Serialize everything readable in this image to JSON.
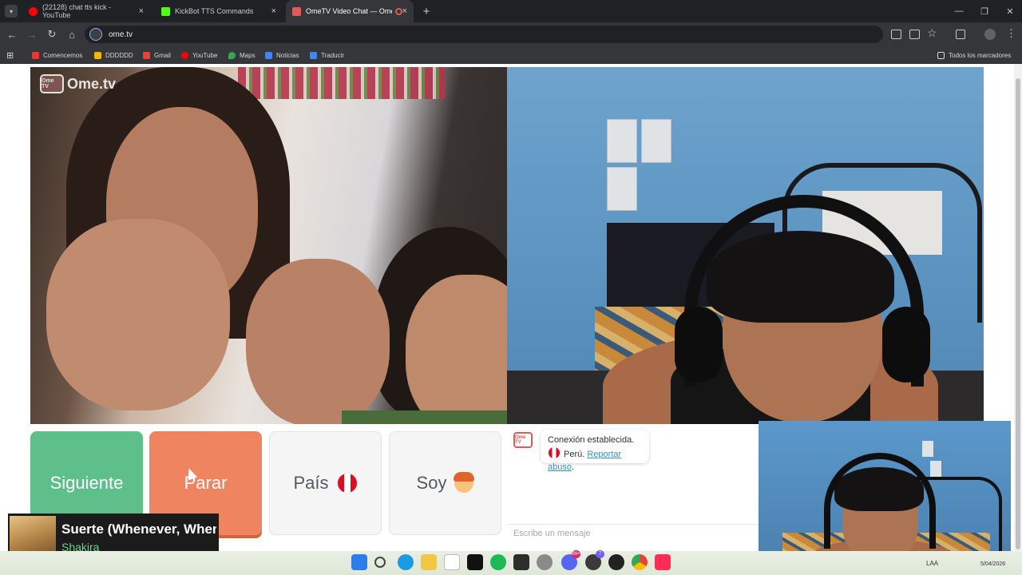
{
  "browser": {
    "tabs": [
      {
        "title": "(22128) chat tts kick - YouTube",
        "icon": "youtube-icon",
        "color": "#ff0000"
      },
      {
        "title": "KickBot TTS Commands",
        "icon": "kickbot-icon",
        "color": "#53fc18"
      },
      {
        "title": "OmeTV Video Chat — Ome",
        "icon": "ometv-icon",
        "color": "#e05a5a",
        "active": true
      }
    ],
    "tab_close": "×",
    "new_tab": "+",
    "window_controls": {
      "minimize": "—",
      "restore": "❐",
      "close": "✕"
    },
    "nav": {
      "back": "←",
      "forward": "→",
      "reload": "↻",
      "home": "⌂"
    },
    "url": "ome.tv",
    "bookmarks": [
      {
        "label": "Comencemos",
        "color": "#e53935"
      },
      {
        "label": "DDDDDD",
        "color": "#f5b700"
      },
      {
        "label": "Gmail",
        "color": "#ea4335"
      },
      {
        "label": "YouTube",
        "color": "#ff0000"
      },
      {
        "label": "Maps",
        "color": "#34a853"
      },
      {
        "label": "Noticias",
        "color": "#4285f4"
      },
      {
        "label": "Traducir",
        "color": "#4285f4"
      }
    ],
    "all_bookmarks": "Todos los marcadores"
  },
  "ometv": {
    "logo_text": "Ome.tv",
    "logo_box": "Ome TV",
    "buttons": {
      "next": "Siguiente",
      "stop": "Parar",
      "country": "País",
      "gender": "Soy"
    },
    "chat": {
      "logo": "Ome TV",
      "status": "Conexión establecida.",
      "country": "Perú.",
      "report_link": "Reportar abuso",
      "report_suffix": ".",
      "input_placeholder": "Escribe un mensaje"
    },
    "colors": {
      "next": "#5ebf8a",
      "stop": "#ee8560",
      "peru_red": "#d91023"
    }
  },
  "now_playing": {
    "title": "Suerte (Whenever, Whenever)",
    "artist": "Shakira"
  },
  "taskbar": {
    "icons": [
      "windows-start-icon",
      "search-icon",
      "edge-icon",
      "file-explorer-icon",
      "store-icon",
      "tiktok-icon",
      "spotify-icon",
      "xbox-icon",
      "game-icon",
      "discord-icon",
      "obs-icon",
      "chrome-icon",
      "tiktok-live-icon"
    ],
    "badges": {
      "discord": "99+",
      "obs": "7"
    },
    "language": "LAA",
    "date": "5/04/2026"
  }
}
